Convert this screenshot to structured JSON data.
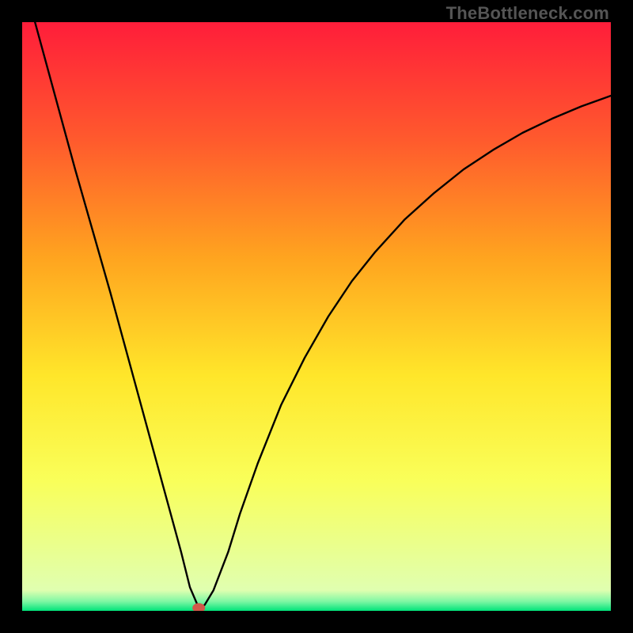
{
  "watermark": "TheBottleneck.com",
  "chart_data": {
    "type": "line",
    "title": "",
    "xlabel": "",
    "ylabel": "",
    "xlim": [
      0,
      100
    ],
    "ylim": [
      0,
      100
    ],
    "series": [
      {
        "name": "curve",
        "x": [
          0,
          3,
          6,
          9,
          12,
          15,
          18,
          21,
          24,
          27,
          28.5,
          30,
          31,
          32.5,
          35,
          37,
          40,
          44,
          48,
          52,
          56,
          60,
          65,
          70,
          75,
          80,
          85,
          90,
          95,
          100
        ],
        "values": [
          108,
          97,
          86,
          75,
          64.5,
          54,
          43,
          32,
          21,
          10,
          4,
          0.5,
          1,
          3.5,
          10,
          16.5,
          25,
          35,
          43,
          50,
          56,
          61,
          66.5,
          71,
          75,
          78.3,
          81.2,
          83.6,
          85.7,
          87.5
        ]
      }
    ],
    "marker": {
      "x": 30,
      "y": 0.5,
      "color": "#d15a4a"
    },
    "gradient_bands": [
      {
        "stop": 0.0,
        "color": "#ff1d3a"
      },
      {
        "stop": 0.2,
        "color": "#ff5a2d"
      },
      {
        "stop": 0.4,
        "color": "#ffa41f"
      },
      {
        "stop": 0.6,
        "color": "#ffe62a"
      },
      {
        "stop": 0.78,
        "color": "#f9ff5a"
      },
      {
        "stop": 0.965,
        "color": "#e0ffb0"
      },
      {
        "stop": 0.984,
        "color": "#7ef7a4"
      },
      {
        "stop": 1.0,
        "color": "#00e37a"
      }
    ]
  }
}
